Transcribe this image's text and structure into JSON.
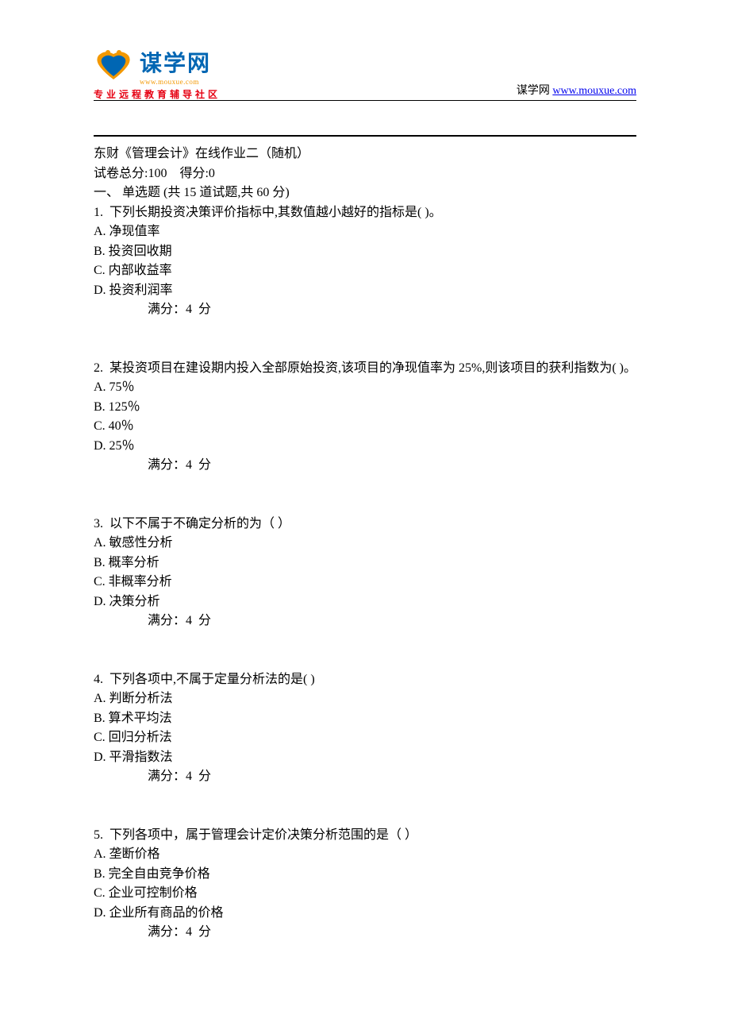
{
  "logo": {
    "main": "谋学网",
    "sub": "www.mouxue.com",
    "tagline": "专业远程教育辅导社区"
  },
  "header_right": {
    "label": "谋学网",
    "link": "www.mouxue.com"
  },
  "document": {
    "title": "东财《管理会计》在线作业二（随机）",
    "score_line": "试卷总分:100    得分:0",
    "section_header": "一、 单选题 (共 15 道试题,共 60 分)",
    "questions": [
      {
        "number": "1.",
        "text": "  下列长期投资决策评价指标中,其数值越小越好的指标是( )。",
        "options": [
          "A. 净现值率",
          "B. 投资回收期",
          "C. 内部收益率",
          "D. 投资利润率"
        ],
        "score": "满分：4  分"
      },
      {
        "number": "2.",
        "text": "  某投资项目在建设期内投入全部原始投资,该项目的净现值率为 25%,则该项目的获利指数为( )。",
        "options": [
          "A. 75％",
          "B. 125％",
          "C. 40％",
          "D. 25％"
        ],
        "score": "满分：4  分"
      },
      {
        "number": "3.",
        "text": "  以下不属于不确定分析的为（ ）",
        "options": [
          "A. 敏感性分析",
          "B. 概率分析",
          "C. 非概率分析",
          "D. 决策分析"
        ],
        "score": "满分：4  分"
      },
      {
        "number": "4.",
        "text": "  下列各项中,不属于定量分析法的是( )",
        "options": [
          "A. 判断分析法",
          "B. 算术平均法",
          "C. 回归分析法",
          "D. 平滑指数法"
        ],
        "score": "满分：4  分"
      },
      {
        "number": "5.",
        "text": "  下列各项中，属于管理会计定价决策分析范围的是（ ）",
        "options": [
          "A. 垄断价格",
          "B. 完全自由竞争价格",
          "C. 企业可控制价格",
          "D. 企业所有商品的价格"
        ],
        "score": "满分：4  分"
      }
    ]
  }
}
